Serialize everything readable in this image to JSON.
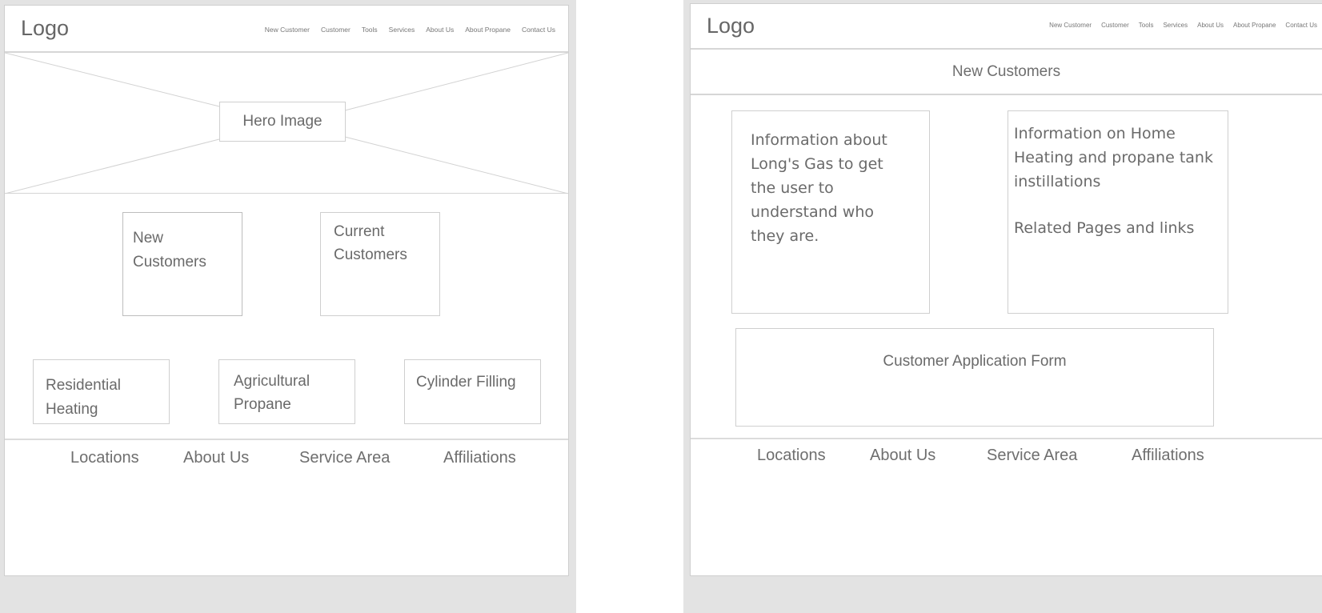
{
  "home_wireframe": {
    "logo": "Logo",
    "nav": [
      "New Customer",
      "Customer",
      "Tools",
      "Services",
      "About Us",
      "About Propane",
      "Contact Us"
    ],
    "hero_label": "Hero Image",
    "customer_boxes": [
      {
        "line1": "New",
        "line2": "Customers"
      },
      {
        "line1": "Current",
        "line2": "Customers"
      }
    ],
    "service_boxes": [
      {
        "line1": "Residential",
        "line2": "Heating"
      },
      {
        "line1": "Agricultural",
        "line2": "Propane"
      },
      {
        "line1": "Cylinder Filling",
        "line2": ""
      }
    ],
    "footer": [
      "Locations",
      "About Us",
      "Service Area",
      "Affiliations"
    ]
  },
  "new_customers_wireframe": {
    "logo": "Logo",
    "nav": [
      "New Customer",
      "Customer",
      "Tools",
      "Services",
      "About Us",
      "About Propane",
      "Contact Us"
    ],
    "page_title": "New Customers",
    "info_left": [
      "Information about",
      "Long's Gas to get",
      "the user to",
      "understand who",
      "they are."
    ],
    "info_right": {
      "lines": [
        "Information on Home",
        "Heating and propane tank",
        "instillations"
      ],
      "related": "Related Pages and links"
    },
    "form_label": "Customer Application Form",
    "footer": [
      "Locations",
      "About Us",
      "Service Area",
      "Affiliations"
    ]
  }
}
